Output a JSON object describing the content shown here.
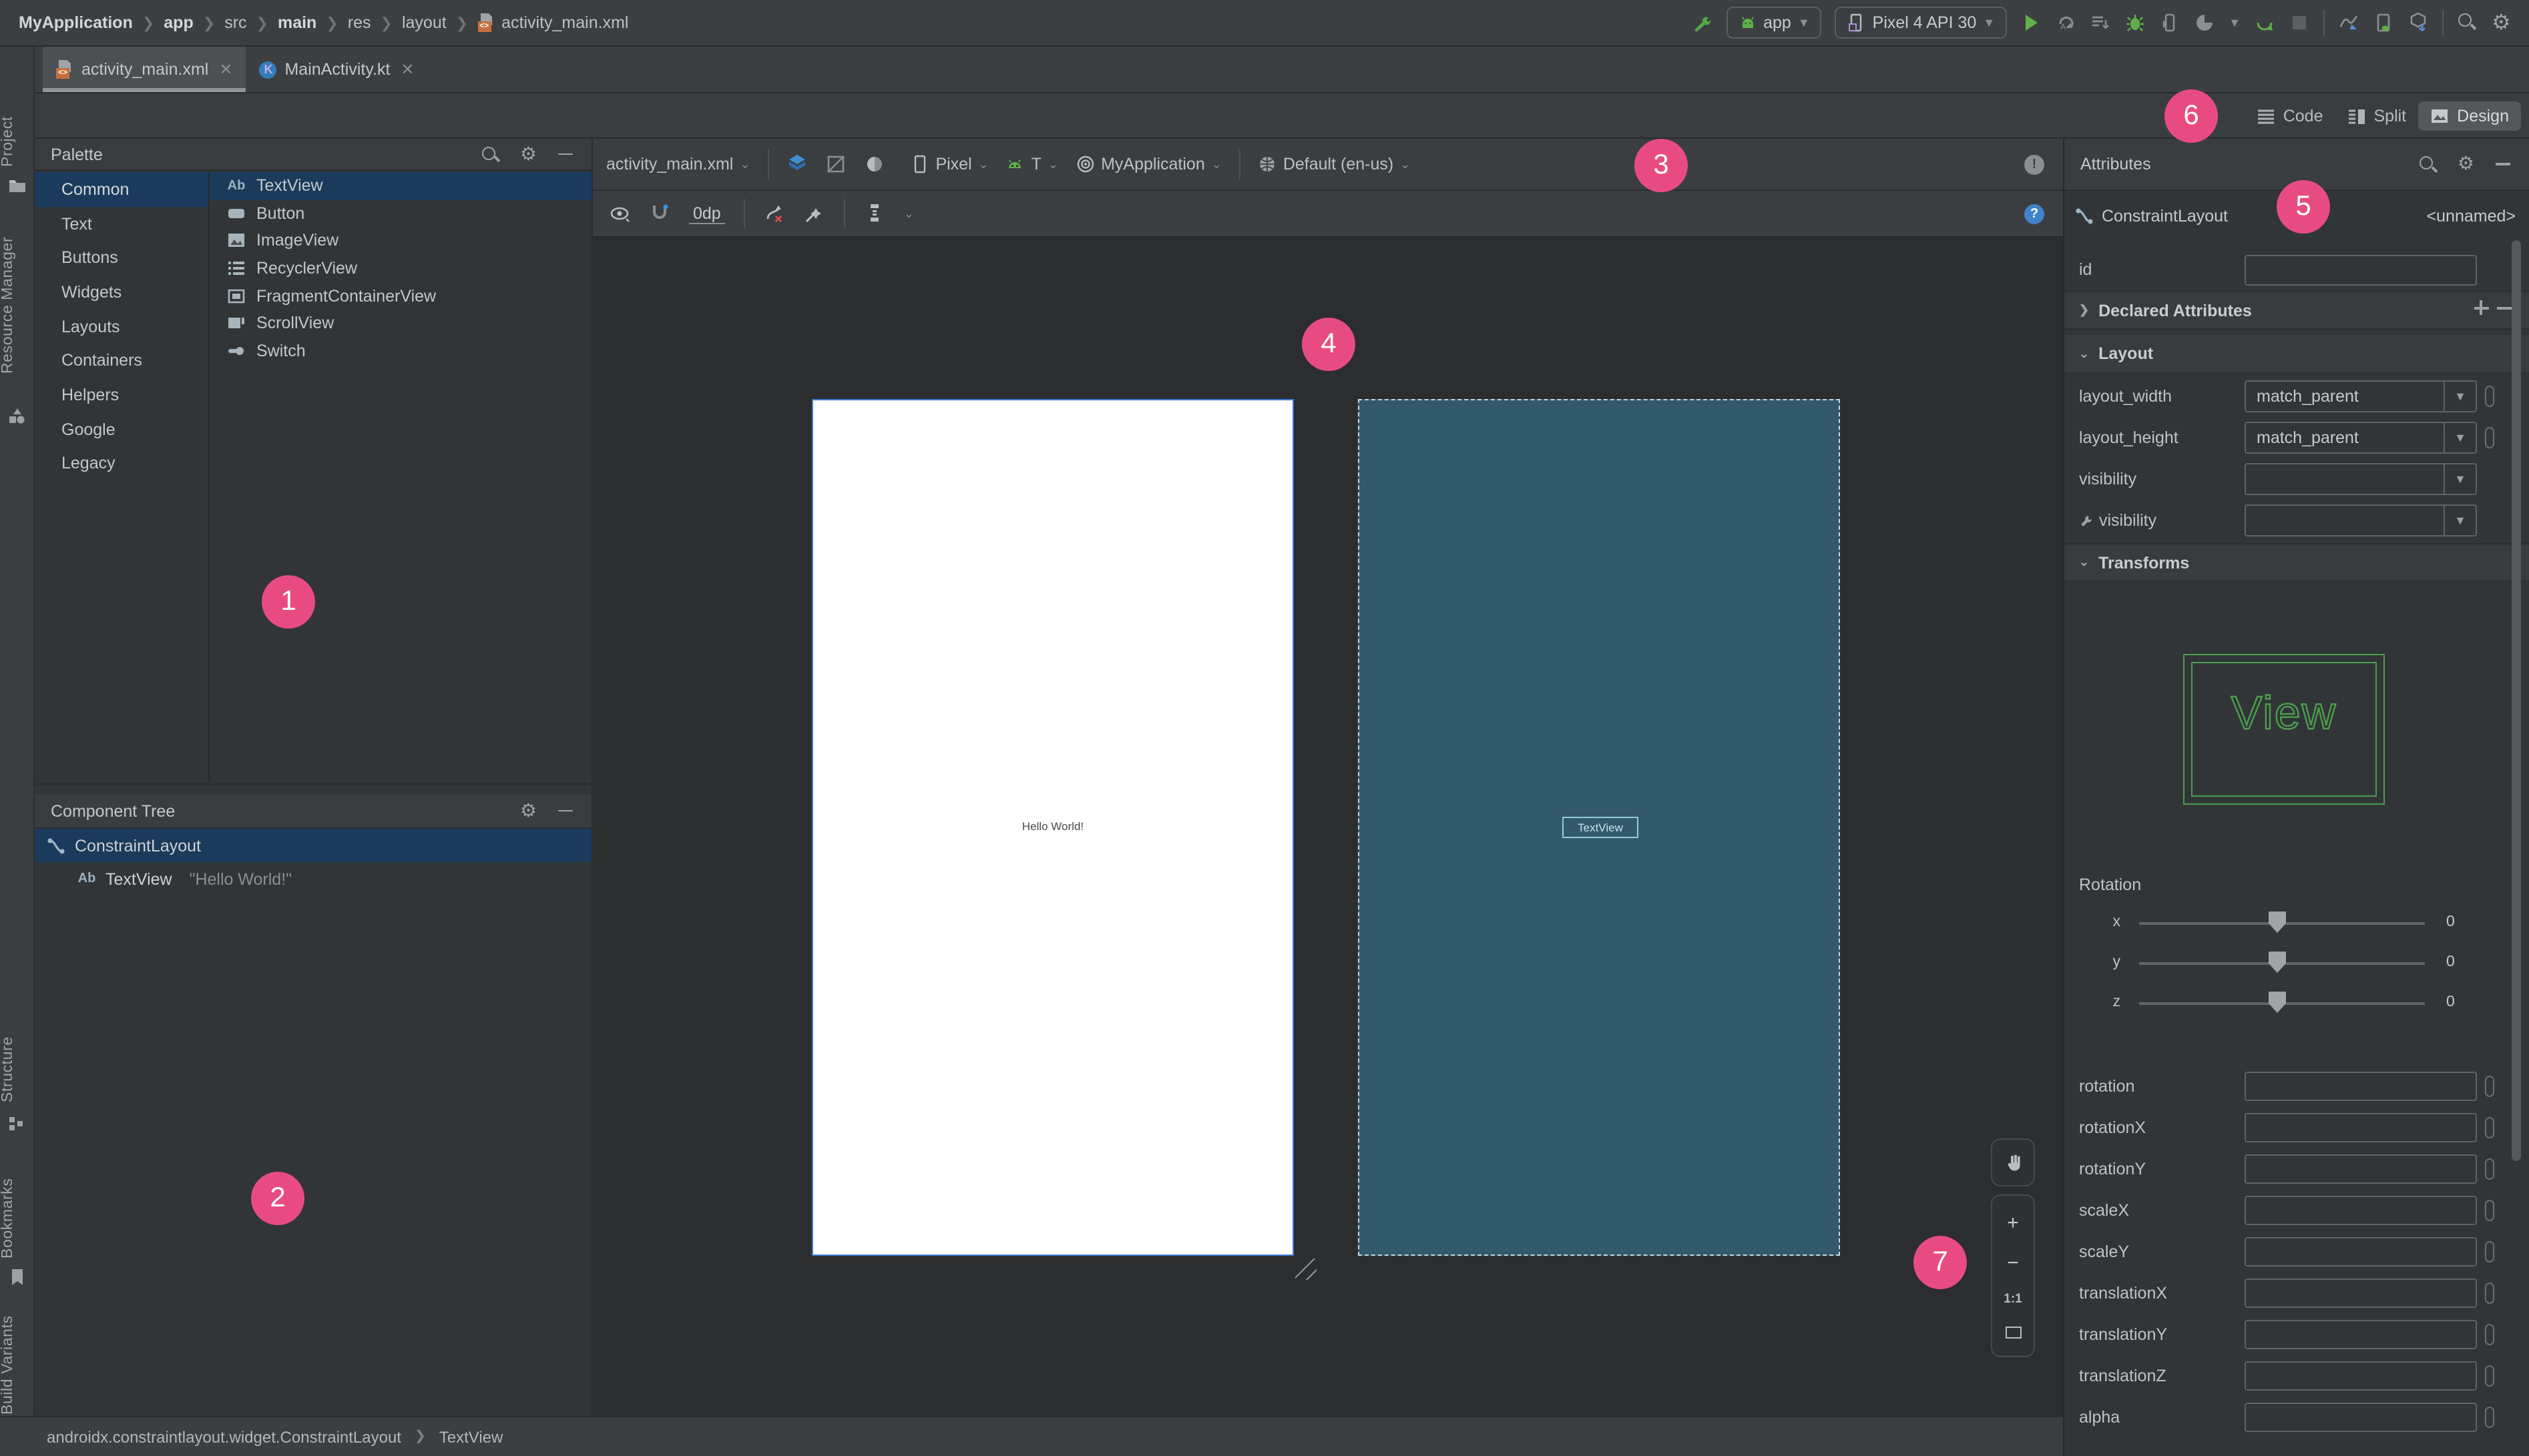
{
  "breadcrumbs": {
    "items": [
      "MyApplication",
      "app",
      "src",
      "main",
      "res",
      "layout",
      "activity_main.xml"
    ]
  },
  "run_toolbar": {
    "module": "app",
    "device": "Pixel 4 API 30"
  },
  "tabs": [
    {
      "label": "activity_main.xml"
    },
    {
      "label": "MainActivity.kt"
    }
  ],
  "view_modes": {
    "code": "Code",
    "split": "Split",
    "design": "Design"
  },
  "design_toolbar": {
    "file": "activity_main.xml",
    "device": "Pixel",
    "api": "T",
    "theme": "MyApplication",
    "locale": "Default (en-us)",
    "default_margin": "0dp"
  },
  "palette": {
    "title": "Palette",
    "categories": [
      {
        "label": "Common",
        "selected": true
      },
      {
        "label": "Text"
      },
      {
        "label": "Buttons"
      },
      {
        "label": "Widgets"
      },
      {
        "label": "Layouts"
      },
      {
        "label": "Containers"
      },
      {
        "label": "Helpers"
      },
      {
        "label": "Google"
      },
      {
        "label": "Legacy"
      }
    ],
    "items": [
      {
        "label": "TextView",
        "selected": true
      },
      {
        "label": "Button"
      },
      {
        "label": "ImageView"
      },
      {
        "label": "RecyclerView"
      },
      {
        "label": "FragmentContainerView"
      },
      {
        "label": "ScrollView"
      },
      {
        "label": "Switch"
      }
    ]
  },
  "component_tree": {
    "title": "Component Tree",
    "nodes": [
      {
        "label": "ConstraintLayout",
        "selected": true
      },
      {
        "label": "TextView",
        "value": "\"Hello World!\""
      }
    ]
  },
  "canvas": {
    "design_text": "Hello World!",
    "blueprint_text": "TextView",
    "one_to_one": "1:1"
  },
  "attributes": {
    "title": "Attributes",
    "component": "ConstraintLayout",
    "component_id": "<unnamed>",
    "id_label": "id",
    "id_value": "",
    "sections": {
      "declared": "Declared Attributes",
      "layout": "Layout",
      "transforms": "Transforms"
    },
    "layout_rows": [
      {
        "label": "layout_width",
        "value": "match_parent"
      },
      {
        "label": "layout_height",
        "value": "match_parent"
      },
      {
        "label": "visibility",
        "value": ""
      },
      {
        "label": "visibility",
        "value": "",
        "tools": true
      }
    ],
    "view_preview": "View",
    "rotation": {
      "title": "Rotation",
      "sliders": [
        {
          "axis": "x",
          "value": "0"
        },
        {
          "axis": "y",
          "value": "0"
        },
        {
          "axis": "z",
          "value": "0"
        }
      ]
    },
    "transform_rows": [
      "rotation",
      "rotationX",
      "rotationY",
      "scaleX",
      "scaleY",
      "translationX",
      "translationY",
      "translationZ",
      "alpha"
    ]
  },
  "status_bar": {
    "path": [
      "androidx.constraintlayout.widget.ConstraintLayout",
      "TextView"
    ]
  },
  "tool_windows": {
    "left_top": [
      "Project",
      "Resource Manager"
    ],
    "left_bottom": [
      "Structure",
      "Bookmarks",
      "Build Variants"
    ]
  },
  "badges": [
    "1",
    "2",
    "3",
    "4",
    "5",
    "6",
    "7"
  ],
  "colors": {
    "badge": "#e84b82",
    "selection": "#1a3b5c",
    "blueprint": "#33596c",
    "android_green": "#5fb04a",
    "view_green": "#4d9e4c",
    "phone_border": "#3f7ed8"
  }
}
